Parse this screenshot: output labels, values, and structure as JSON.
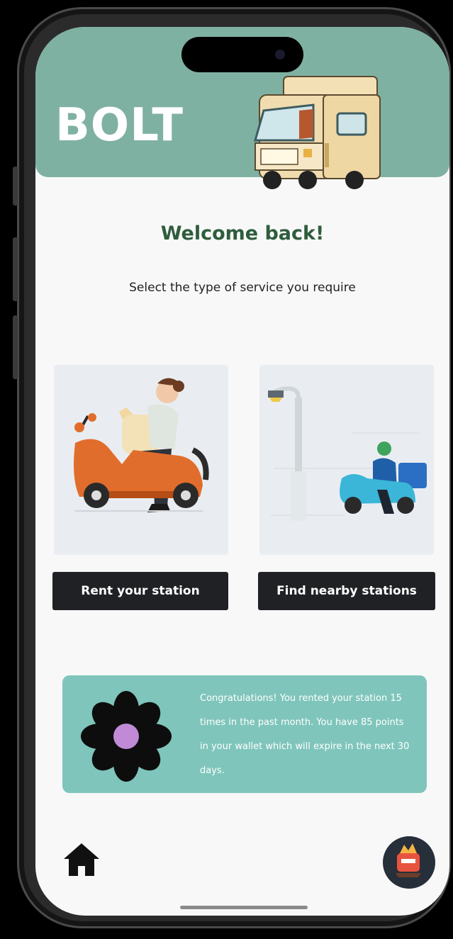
{
  "app": {
    "brand": "BOLT"
  },
  "main": {
    "heading": "Welcome back!",
    "subtitle": "Select the type of service you require",
    "services": [
      {
        "label": "Rent your station",
        "image": "person-on-scooter-illustration"
      },
      {
        "label": "Find nearby stations",
        "image": "delivery-scooter-streetlamp-illustration"
      }
    ]
  },
  "promo": {
    "icon": "flower-icon",
    "message": "Congratulations! You rented your station 15 times in the past month. You have 85 points in your wallet which will expire in the next 30 days."
  },
  "nav": {
    "home_icon": "home-icon",
    "profile_icon": "avatar"
  },
  "colors": {
    "header": "#7fb1a3",
    "heading": "#2f5d3c",
    "button": "#1f2124",
    "promo": "#7fc5bb",
    "background": "#f8f8f9"
  }
}
